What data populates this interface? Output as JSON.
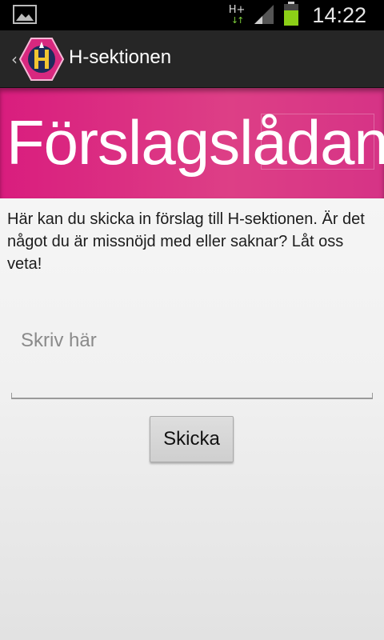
{
  "status_bar": {
    "image_icon": "image-notification-icon",
    "network_type": "H+",
    "signal_icon": "signal-strength-icon",
    "battery_icon": "battery-icon",
    "time": "14:22"
  },
  "action_bar": {
    "up_icon": "chevron-left-icon",
    "logo_icon": "h-section-logo-icon",
    "title": "H-sektionen"
  },
  "banner": {
    "title": "Förslagslådan",
    "color": "#d91d7e"
  },
  "form": {
    "description": "Här kan du skicka in förslag till H-sektionen. Är det något du är missnöjd med eller saknar? Låt oss veta!",
    "input_placeholder": "Skriv här",
    "input_value": "",
    "submit_label": "Skicka"
  }
}
